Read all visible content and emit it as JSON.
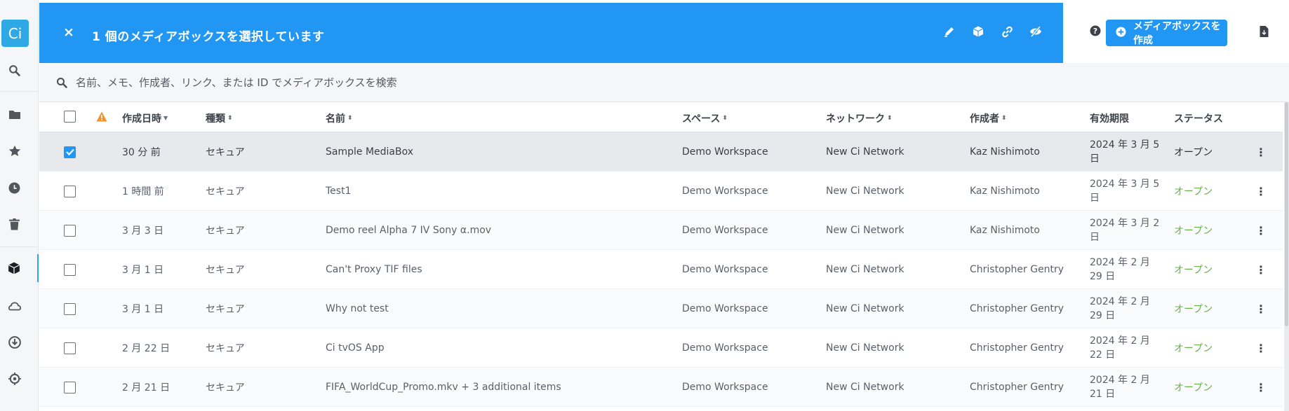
{
  "app": {
    "logo_text": "Ci"
  },
  "sidebar": {
    "items": [
      {
        "name": "search-icon"
      },
      {
        "name": "folder-icon"
      },
      {
        "name": "star-icon"
      },
      {
        "name": "clock-icon"
      },
      {
        "name": "trash-icon"
      },
      {
        "name": "box-icon",
        "active": true
      },
      {
        "name": "network-icon"
      },
      {
        "name": "download-icon"
      },
      {
        "name": "target-icon"
      }
    ]
  },
  "header": {
    "close_label": "×",
    "title": "1 個のメディアボックスを選択しています",
    "actions": [
      "edit-icon",
      "box-icon",
      "link-icon",
      "hide-icon"
    ]
  },
  "topright": {
    "create_label": "メディアボックスを作成"
  },
  "search": {
    "placeholder": "名前、メモ、作成者、リンク、または ID でメディアボックスを検索"
  },
  "table": {
    "headers": {
      "created": "作成日時",
      "type": "種類",
      "name": "名前",
      "space": "スペース",
      "network": "ネットワーク",
      "author": "作成者",
      "expires": "有効期限",
      "status": "ステータス"
    },
    "rows": [
      {
        "checked": true,
        "created": "30 分 前",
        "type": "セキュア",
        "name": "Sample MediaBox",
        "space": "Demo Workspace",
        "network": "New Ci Network",
        "author": "Kaz Nishimoto",
        "expires": "2024 年 3 月 5 日",
        "status": "オープン"
      },
      {
        "checked": false,
        "created": "1 時間 前",
        "type": "セキュア",
        "name": "Test1",
        "space": "Demo Workspace",
        "network": "New Ci Network",
        "author": "Kaz Nishimoto",
        "expires": "2024 年 3 月 5 日",
        "status": "オープン"
      },
      {
        "checked": false,
        "created": "3 月 3 日",
        "type": "セキュア",
        "name": "Demo reel Alpha 7 IV Sony α.mov",
        "space": "Demo Workspace",
        "network": "New Ci Network",
        "author": "Kaz Nishimoto",
        "expires": "2024 年 3 月 2 日",
        "status": "オープン"
      },
      {
        "checked": false,
        "created": "3 月 1 日",
        "type": "セキュア",
        "name": "Can't Proxy TIF files",
        "space": "Demo Workspace",
        "network": "New Ci Network",
        "author": "Christopher Gentry",
        "expires": "2024 年 2 月 29 日",
        "status": "オープン"
      },
      {
        "checked": false,
        "created": "3 月 1 日",
        "type": "セキュア",
        "name": "Why not test",
        "space": "Demo Workspace",
        "network": "New Ci Network",
        "author": "Christopher Gentry",
        "expires": "2024 年 2 月 29 日",
        "status": "オープン"
      },
      {
        "checked": false,
        "created": "2 月 22 日",
        "type": "セキュア",
        "name": "Ci tvOS App",
        "space": "Demo Workspace",
        "network": "New Ci Network",
        "author": "Christopher Gentry",
        "expires": "2024 年 2 月 22 日",
        "status": "オープン"
      },
      {
        "checked": false,
        "created": "2 月 21 日",
        "type": "セキュア",
        "name": "FIFA_WorldCup_Promo.mkv + 3 additional items",
        "space": "Demo Workspace",
        "network": "New Ci Network",
        "author": "Christopher Gentry",
        "expires": "2024 年 2 月 21 日",
        "status": "オープン"
      }
    ]
  },
  "colors": {
    "accent": "#2196f3",
    "logo": "#2fa9e6",
    "status_open": "#6ab04c",
    "warning": "#f0932b"
  }
}
